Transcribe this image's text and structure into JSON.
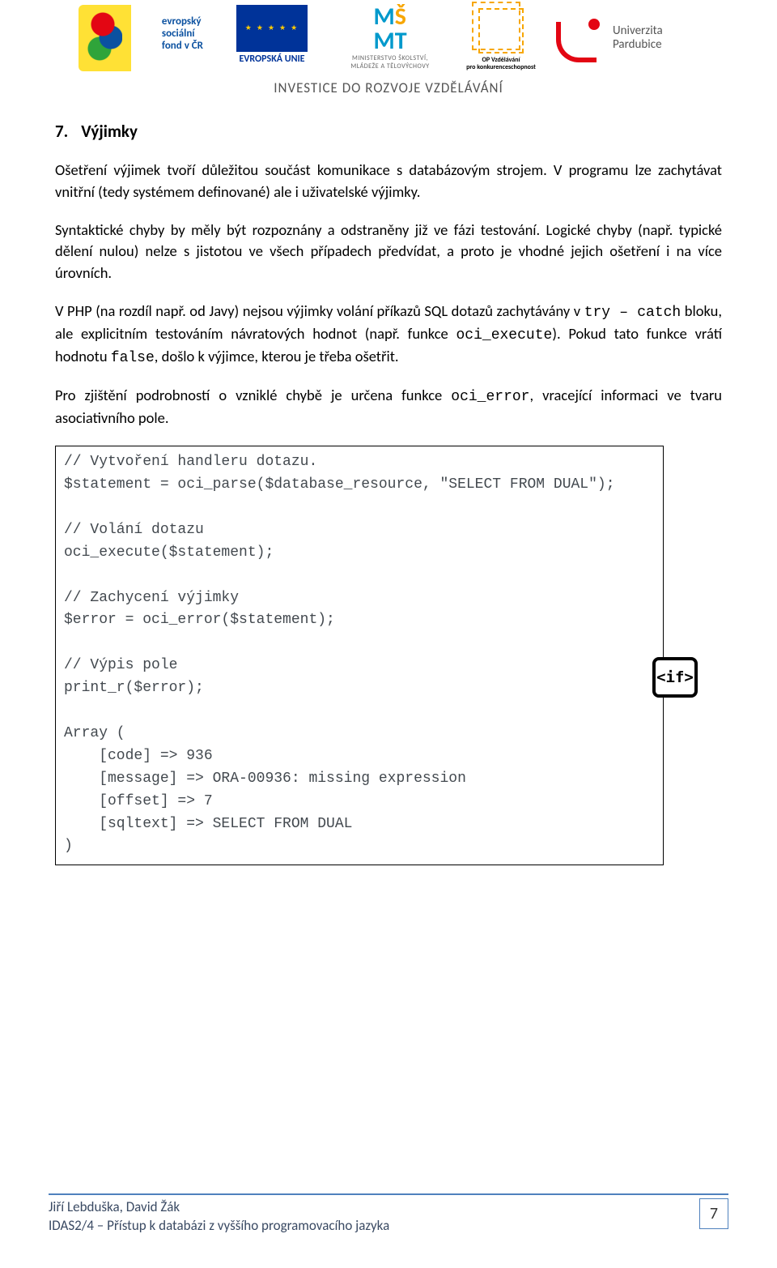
{
  "header": {
    "esf_lines": "evropský\nsociální\nfond v ČR",
    "eu_label": "EVROPSKÁ UNIE",
    "msmt_glyph_M1": "M",
    "msmt_glyph_S": "Š",
    "msmt_glyph_M2": "M",
    "msmt_glyph_T": "T",
    "msmt_sub": "MINISTERSTVO ŠKOLSTVÍ,\nMLÁDEŽE A TĚLOVÝCHOVY",
    "op_label": "OP Vzdělávání\npro konkurenceschopnost",
    "up_text": "Univerzita\nPardubice",
    "tagline": "INVESTICE DO ROZVOJE VZDĚLÁVÁNÍ"
  },
  "section": {
    "number": "7.",
    "title": "Výjimky"
  },
  "paragraphs": {
    "p1": "Ošetření výjimek tvoří důležitou součást komunikace s databázovým strojem. V programu lze zachytávat vnitřní (tedy systémem definované) ale i uživatelské výjimky.",
    "p2": "Syntaktické chyby by měly být rozpoznány a odstraněny již ve fázi testování. Logické chyby (např. typické dělení nulou) nelze s jistotou ve všech případech předvídat, a proto je vhodné jejich ošetření i na více úrovních.",
    "p3a": "V PHP (na rozdíl např. od Javy) nejsou výjimky volání příkazů SQL dotazů zachytávány v ",
    "p3_code1": "try – catch",
    "p3b": " bloku, ale explicitním testováním návratových hodnot (např. funkce ",
    "p3_code2": "oci_execute",
    "p3c": "). Pokud tato funkce vrátí hodnotu ",
    "p3_code3": "false",
    "p3d": ", došlo k výjimce, kterou je třeba ošetřit.",
    "p4a": "Pro zjištění podrobností o vzniklé chybě je určena funkce ",
    "p4_code1": "oci_error",
    "p4b": ", vracející informaci ve tvaru asociativního pole."
  },
  "code": "// Vytvoření handleru dotazu.\n$statement = oci_parse($database_resource, \"SELECT FROM DUAL\");\n\n// Volání dotazu\noci_execute($statement);\n\n// Zachycení výjimky\n$error = oci_error($statement);\n\n// Výpis pole\nprint_r($error);\n\nArray (\n    [code] => 936\n    [message] => ORA-00936: missing expression\n    [offset] => 7\n    [sqltext] => SELECT FROM DUAL\n)",
  "side_icon_label": "<if>",
  "footer": {
    "authors": "Jiří Lebduška, David Žák",
    "course": "IDAS2/4 – Přístup k databázi z vyššího programovacího jazyka",
    "page": "7"
  }
}
